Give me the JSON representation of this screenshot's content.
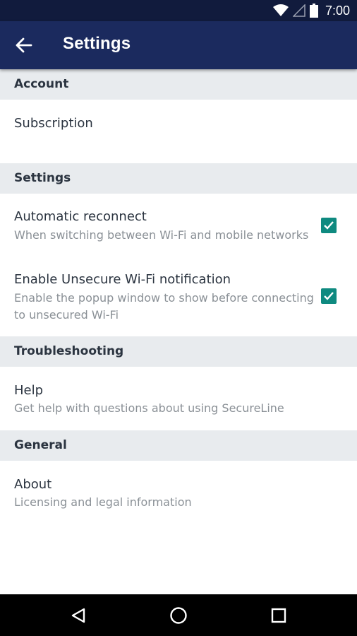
{
  "status_bar": {
    "time": "7:00",
    "icons": [
      "wifi-icon",
      "signal-icon",
      "battery-icon"
    ]
  },
  "app_bar": {
    "title": "Settings",
    "back_icon": "arrow-left-icon"
  },
  "sections": {
    "account": {
      "header": "Account",
      "subscription": {
        "title": "Subscription"
      }
    },
    "settings": {
      "header": "Settings",
      "auto_reconnect": {
        "title": "Automatic reconnect",
        "subtitle": "When switching between Wi-Fi and mobile networks",
        "checked": true
      },
      "unsecure_wifi": {
        "title": "Enable Unsecure Wi-Fi notification",
        "subtitle": "Enable the popup window to show before connecting to unsecured Wi-Fi",
        "checked": true
      }
    },
    "troubleshooting": {
      "header": "Troubleshooting",
      "help": {
        "title": "Help",
        "subtitle": "Get help with questions about using SecureLine"
      }
    },
    "general": {
      "header": "General",
      "about": {
        "title": "About",
        "subtitle": "Licensing and legal information"
      }
    }
  },
  "colors": {
    "status_bar": "#111b3d",
    "app_bar": "#1b2a5e",
    "section_bg": "#e8ebee",
    "checkbox": "#0f8a80"
  },
  "nav_bar": {
    "icons": [
      "back-triangle-icon",
      "home-circle-icon",
      "recents-square-icon"
    ]
  }
}
